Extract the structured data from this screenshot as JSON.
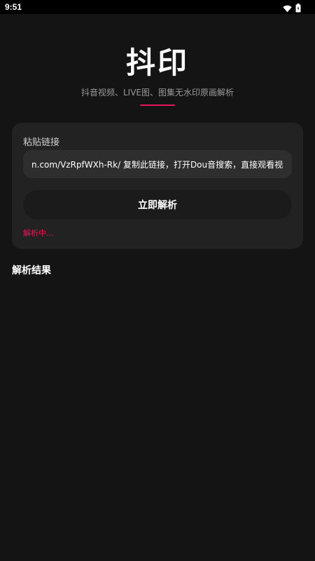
{
  "status_bar": {
    "time": "9:51",
    "icons": [
      "wifi-icon",
      "battery-icon"
    ]
  },
  "app": {
    "title": "抖印",
    "subtitle": "抖音视频、LIVE图、图集无水印原画解析",
    "accent_color": "#e8155a"
  },
  "form": {
    "label": "粘贴链接",
    "link_value": "n.com/VzRpfWXh-Rk/ 复制此链接，打开Dou音搜索，直接观看视频!",
    "button_label": "立即解析",
    "status": "解析中..."
  },
  "results": {
    "title": "解析结果"
  },
  "colors": {
    "background": "#141414",
    "card": "#222222",
    "input": "#2e2e2e",
    "button": "#1b1b1b",
    "accent": "#e8155a"
  }
}
